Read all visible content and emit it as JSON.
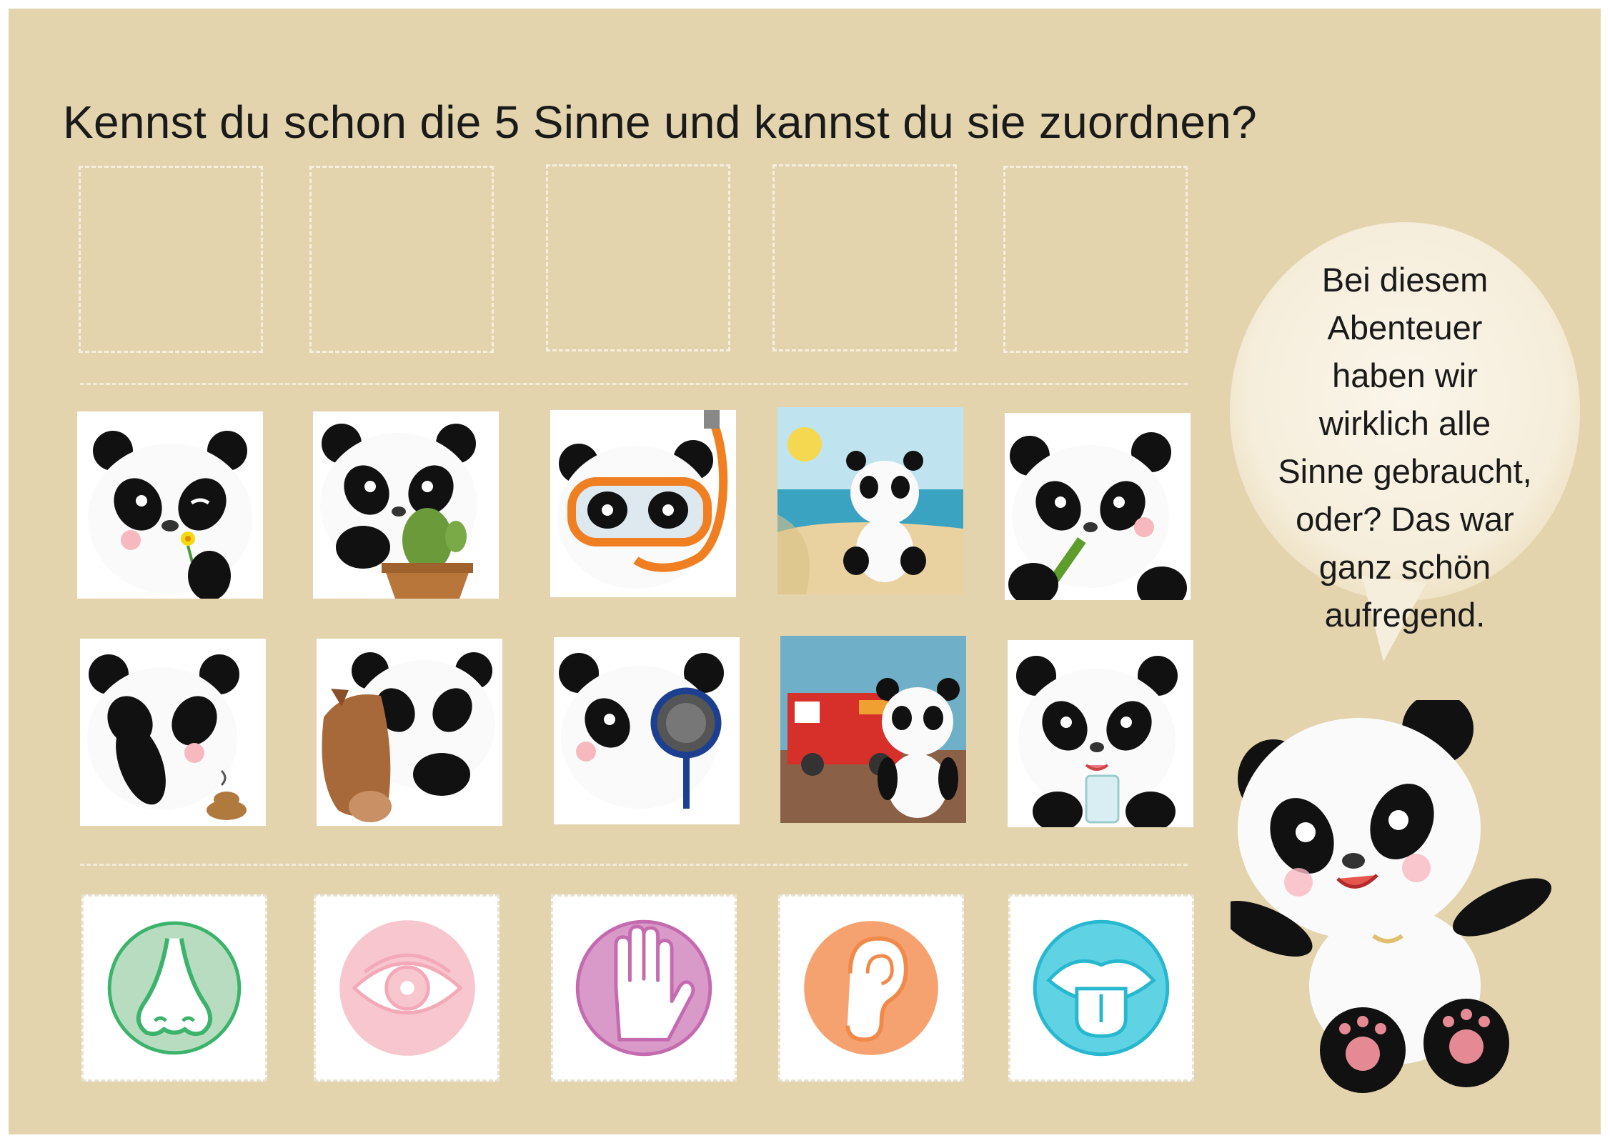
{
  "worksheet": {
    "title": "Kennst du schon die 5 Sinne und kannst du sie zuordnen?",
    "slots": [
      "",
      "",
      "",
      "",
      ""
    ],
    "scene_cards": [
      {
        "icon": "panda-smelling-flower-icon"
      },
      {
        "icon": "panda-touching-cactus-icon"
      },
      {
        "icon": "panda-snorkel-mask-icon"
      },
      {
        "icon": "panda-on-beach-icon"
      },
      {
        "icon": "panda-eating-bamboo-icon"
      },
      {
        "icon": "panda-holding-nose-icon"
      },
      {
        "icon": "panda-petting-horse-icon"
      },
      {
        "icon": "panda-magnifying-glass-icon"
      },
      {
        "icon": "panda-fire-truck-icon"
      },
      {
        "icon": "panda-drinking-water-icon"
      }
    ],
    "sense_cards": [
      {
        "icon": "nose-icon",
        "color": "#3bb36a",
        "fill": "#b7dcc0"
      },
      {
        "icon": "eye-icon",
        "color": "#f3a9b8",
        "fill": "#f8c6cf"
      },
      {
        "icon": "hand-icon",
        "color": "#c46bb0",
        "fill": "#d99ac9"
      },
      {
        "icon": "ear-icon",
        "color": "#f08a4b",
        "fill": "#f6a270"
      },
      {
        "icon": "tongue-mouth-icon",
        "color": "#27b7cf",
        "fill": "#5fd3e4"
      }
    ]
  },
  "speech_bubble": {
    "lines": [
      "Bei diesem",
      "Abenteuer",
      "haben wir",
      "wirklich alle",
      "Sinne gebraucht,",
      "oder? Das war",
      "ganz schön",
      "aufregend."
    ]
  },
  "colors": {
    "background": "#e4d4ae",
    "dashes": "#f6efe0"
  }
}
